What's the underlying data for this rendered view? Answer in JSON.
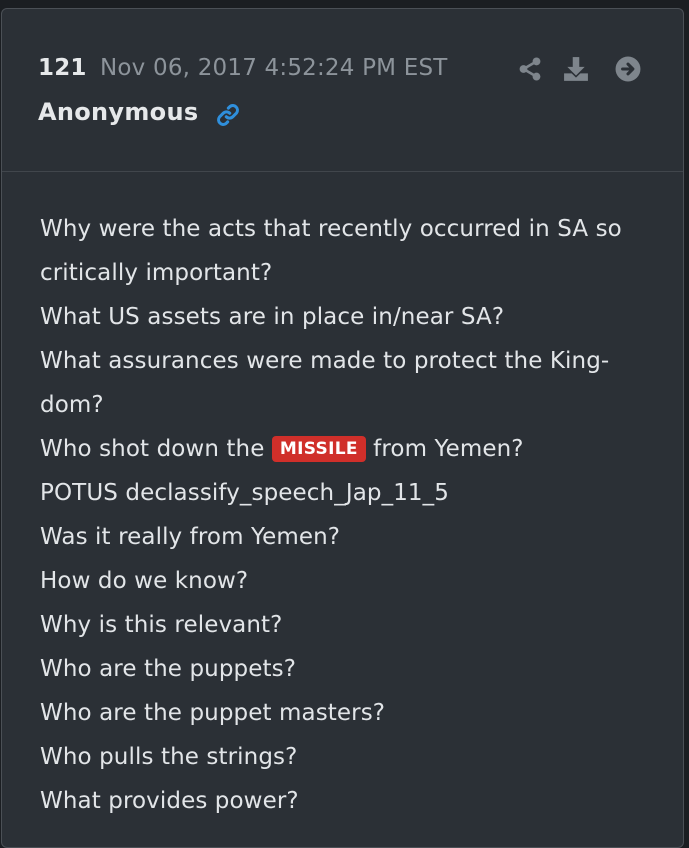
{
  "post": {
    "number": "121",
    "date": "Nov 06, 2017 4:52:24 PM EST",
    "author": "Anonymous"
  },
  "icons": {
    "link": "link-icon",
    "share": "share-icon",
    "download": "download-icon",
    "go": "arrow-circle-right-icon"
  },
  "colors": {
    "card_background": "#2b3036",
    "text": "#e2e5e8",
    "muted": "#8d949b",
    "link_accent": "#2f8fdc",
    "badge": "#d02f2a"
  },
  "body": {
    "line1": "Why were the acts that recently occurred in SA so",
    "line2": "critically important?",
    "line3": "What US assets are in place in/near SA?",
    "line4": "What assurances were made to protect the King-",
    "line5": "dom?",
    "line6_before": "Who shot down the",
    "line6_badge": "MISSILE",
    "line6_after": "from Yemen?",
    "line7": "POTUS declassify_speech_Jap_11_5",
    "line8": "Was it really from Yemen?",
    "line9": "How do we know?",
    "line10": "Why is this relevant?",
    "line11": "Who are the puppets?",
    "line12": "Who are the puppet masters?",
    "line13": "Who pulls the strings?",
    "line14": "What provides power?"
  }
}
